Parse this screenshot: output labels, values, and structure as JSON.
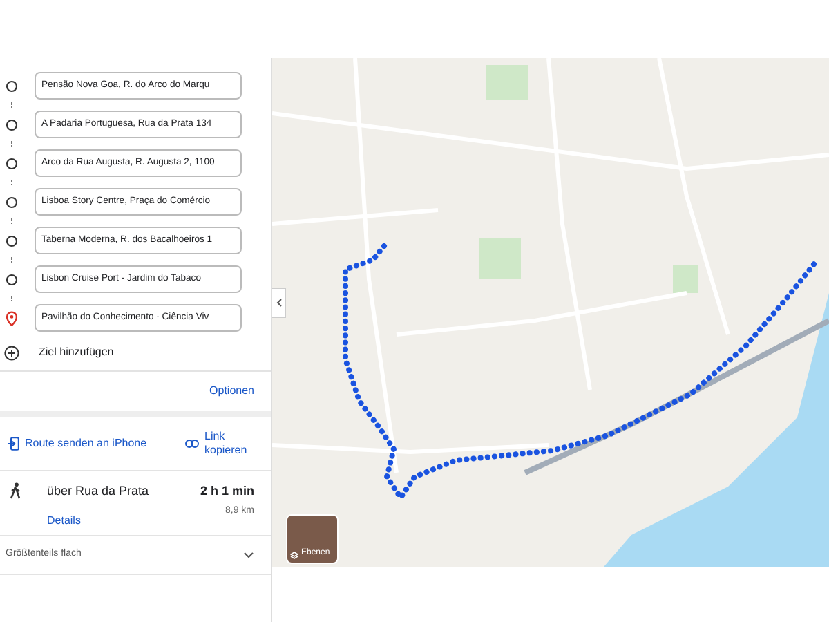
{
  "waypoints": [
    {
      "kind": "stop",
      "text": "Pensão Nova Goa, R. do Arco do Marqu"
    },
    {
      "kind": "stop",
      "text": "A Padaria Portuguesa, Rua da Prata 134"
    },
    {
      "kind": "stop",
      "text": "Arco da Rua Augusta, R. Augusta 2, 1100"
    },
    {
      "kind": "stop",
      "text": "Lisboa Story Centre, Praça do Comércio"
    },
    {
      "kind": "stop",
      "text": "Taberna Moderna, R. dos Bacalhoeiros 1"
    },
    {
      "kind": "stop",
      "text": "Lisbon Cruise Port - Jardim do Tabaco"
    },
    {
      "kind": "destination",
      "text": "Pavilhão do Conhecimento - Ciência Viv"
    }
  ],
  "add_destination": "Ziel hinzufügen",
  "options": "Optionen",
  "share": {
    "send": "Route senden an iPhone",
    "copy": "Link kopieren"
  },
  "route": {
    "via": "über Rua da Prata",
    "duration": "2 h 1 min",
    "distance": "8,9 km",
    "details": "Details"
  },
  "elevation": {
    "label": "Größtenteils flach",
    "expanded": false
  },
  "map": {
    "layers_label": "Ebenen"
  }
}
